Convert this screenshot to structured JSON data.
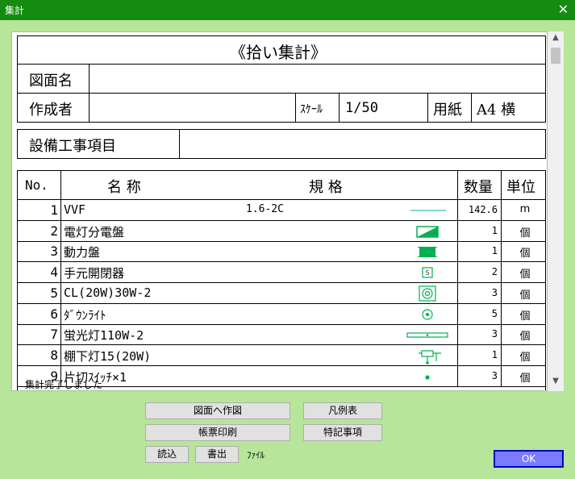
{
  "window": {
    "title": "集計",
    "close": "✕"
  },
  "sheet": {
    "heading": "《拾い集計》",
    "labels": {
      "drawing_name": "図面名",
      "author": "作成者",
      "scale_label": "ｽｹｰﾙ",
      "scale_value": "1/50",
      "paper_label": "用紙",
      "paper_value": "A4 横",
      "work_item": "設備工事項目"
    },
    "columns": {
      "no": "No.",
      "name": "名 称",
      "spec": "規 格",
      "qty": "数量",
      "unit": "単位"
    },
    "rows": [
      {
        "no": "1",
        "name": "VVF",
        "spec": "1.6-2C",
        "symbol": "line-icon",
        "qty": "142.6",
        "unit": "m"
      },
      {
        "no": "2",
        "name": "電灯分電盤",
        "spec": "",
        "symbol": "lighting-panel-icon",
        "qty": "1",
        "unit": "個"
      },
      {
        "no": "3",
        "name": "動力盤",
        "spec": "",
        "symbol": "power-panel-icon",
        "qty": "1",
        "unit": "個"
      },
      {
        "no": "4",
        "name": "手元開閉器",
        "spec": "",
        "symbol": "local-switch-icon",
        "qty": "2",
        "unit": "個"
      },
      {
        "no": "5",
        "name": "CL(20W)30W-2",
        "spec": "",
        "symbol": "ceiling-light-icon",
        "qty": "3",
        "unit": "個"
      },
      {
        "no": "6",
        "name": "ﾀﾞｳﾝﾗｲﾄ",
        "spec": "",
        "symbol": "downlight-icon",
        "qty": "5",
        "unit": "個"
      },
      {
        "no": "7",
        "name": "蛍光灯110W-2",
        "spec": "",
        "symbol": "fluorescent-light-icon",
        "qty": "3",
        "unit": "個"
      },
      {
        "no": "8",
        "name": "棚下灯15(20W)",
        "spec": "",
        "symbol": "under-shelf-light-icon",
        "qty": "1",
        "unit": "個"
      },
      {
        "no": "9",
        "name": "片切ｽｲｯﾁ×1",
        "spec": "",
        "symbol": "single-switch-icon",
        "qty": "3",
        "unit": "個"
      }
    ]
  },
  "status": "集計完了しました",
  "buttons": {
    "to_drawing": "図面へ作図",
    "legend": "凡例表",
    "print": "帳票印刷",
    "notes": "特記事項",
    "load": "読込",
    "export": "書出",
    "file_label": "ﾌｧｲﾙ",
    "ok": "OK"
  },
  "colors": {
    "titlebar": "#168b12",
    "frame": "#b7e59a",
    "symbol": "#00b050",
    "ok": "#7b7bff"
  }
}
